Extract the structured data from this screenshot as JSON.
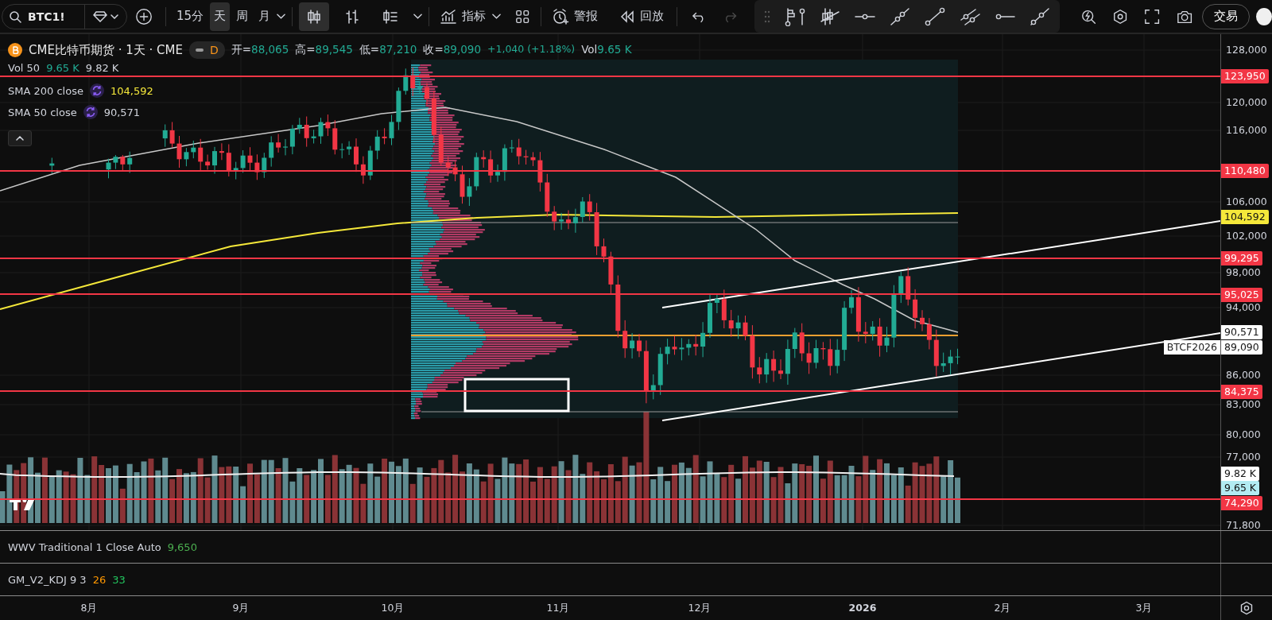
{
  "toolbar": {
    "symbol_search": {
      "value": "BTC1!"
    },
    "intervals": [
      {
        "label": "15分",
        "selected": false
      },
      {
        "label": "天",
        "selected": true
      },
      {
        "label": "周",
        "selected": false
      },
      {
        "label": "月",
        "selected": false
      }
    ],
    "chart_types": [
      {
        "kind": "candles",
        "selected": true
      },
      {
        "kind": "bars",
        "selected": false
      },
      {
        "kind": "hollow",
        "selected": false
      }
    ],
    "indicators_button": {
      "label": "指标"
    },
    "alert_button": {
      "label": "警报"
    },
    "replay_button": {
      "label": "回放"
    },
    "undo": {
      "disabled": false
    },
    "redo": {
      "disabled": true
    },
    "trade_button": {
      "label": "交易"
    }
  },
  "legend": {
    "title": "CME比特币期货 · 1天 · CME",
    "interval_badge": "D",
    "ohlc": [
      {
        "label": "开=",
        "value": "88,065"
      },
      {
        "label": "高=",
        "value": "89,545"
      },
      {
        "label": "低=",
        "value": "87,210"
      },
      {
        "label": "收=",
        "value": "89,090"
      }
    ],
    "change": "+1,040 (+1.18%)",
    "volume": {
      "label": "Vol",
      "value": "9.65 K"
    }
  },
  "indicators": [
    {
      "name": "Vol 50",
      "kind": "volume",
      "values": [
        {
          "text": "9.65 K",
          "color": "#22ab94"
        },
        {
          "text": "9.82 K",
          "color": "#d1d4dc"
        }
      ]
    },
    {
      "name": "SMA 200 close",
      "kind": "sma",
      "values": [
        {
          "text": "104,592",
          "color": "#f5e83a"
        }
      ]
    },
    {
      "name": "SMA 50 close",
      "kind": "sma",
      "values": [
        {
          "text": "90,571",
          "color": "#d1d4dc"
        }
      ]
    }
  ],
  "price_axis": {
    "ticks": [
      "128,000",
      "120,000",
      "116,000",
      "106,000",
      "102,000",
      "98,000",
      "94,000",
      "86,000",
      "83,000",
      "80,000",
      "77,000",
      "71,800"
    ],
    "markers": [
      {
        "text": "123,950",
        "color": "#f23645",
        "line": true
      },
      {
        "text": "110,480",
        "color": "#f23645",
        "line": true
      },
      {
        "text": "104,592",
        "color": "#f5e83a",
        "line": false
      },
      {
        "text": "99,295",
        "color": "#f23645",
        "line": true
      },
      {
        "text": "95,025",
        "color": "#f23645",
        "line": true
      },
      {
        "text": "90,571",
        "color": "#ffffff",
        "line": false
      },
      {
        "text": "89,090",
        "color": "#ffffff",
        "line": false,
        "tag": "BTCF2026"
      },
      {
        "text": "84,375",
        "color": "#f23645",
        "line": true
      },
      {
        "text": "9.82 K",
        "color": "#ffffff",
        "line": false
      },
      {
        "text": "9.65 K",
        "color": "#b2ebf2",
        "line": false
      },
      {
        "text": "74,290",
        "color": "#f23645",
        "line": true
      }
    ]
  },
  "panes": [
    {
      "name": "WWV Traditional 1 Close Auto",
      "values": [
        {
          "text": "9,650",
          "color": "#4caf50"
        }
      ]
    },
    {
      "name": "GM_V2_KDJ 9 3",
      "values": [
        {
          "text": "26",
          "color": "#ff9800"
        },
        {
          "text": "33",
          "color": "#22c55e"
        }
      ]
    }
  ],
  "time_axis": {
    "labels": [
      {
        "text": "8月",
        "kind": "month"
      },
      {
        "text": "9月",
        "kind": "month"
      },
      {
        "text": "10月",
        "kind": "month"
      },
      {
        "text": "11月",
        "kind": "month"
      },
      {
        "text": "12月",
        "kind": "month"
      },
      {
        "text": "2026",
        "kind": "year"
      },
      {
        "text": "2月",
        "kind": "month"
      },
      {
        "text": "3月",
        "kind": "month"
      }
    ]
  }
}
